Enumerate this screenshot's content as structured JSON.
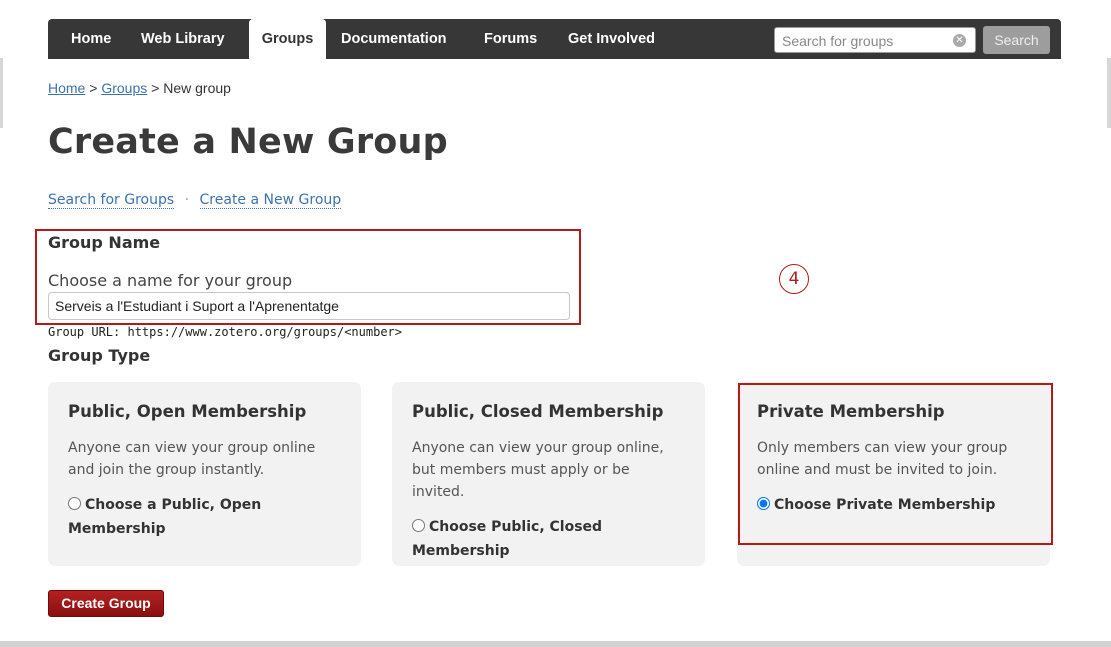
{
  "nav": {
    "items": [
      "Home",
      "Web Library",
      "Groups",
      "Documentation",
      "Forums",
      "Get Involved"
    ],
    "active": "Groups",
    "search_placeholder": "Search for groups",
    "search_button": "Search"
  },
  "breadcrumb": {
    "home": "Home",
    "sep1": ">",
    "groups": "Groups",
    "sep2": ">",
    "current": "New group"
  },
  "page_title": "Create a New Group",
  "subnav": {
    "search_groups": "Search for Groups",
    "dot": "·",
    "create_group": "Create a New Group"
  },
  "group_name": {
    "heading": "Group Name",
    "label": "Choose a name for your group",
    "value": "Serveis a l'Estudiant i Suport a l'Aprenentatge",
    "url_hint": "Group URL: https://www.zotero.org/groups/<number>"
  },
  "group_type": {
    "heading": "Group Type",
    "options": [
      {
        "title": "Public, Open Membership",
        "description": "Anyone can view your group online and join the group instantly.",
        "choice": "Choose a Public, Open Membership",
        "selected": false
      },
      {
        "title": "Public, Closed Membership",
        "description": "Anyone can view your group online, but members must apply or be invited.",
        "choice": "Choose Public, Closed Membership",
        "selected": false
      },
      {
        "title": "Private Membership",
        "description": "Only members can view your group online and must be invited to join.",
        "choice": "Choose Private Membership",
        "selected": true
      }
    ]
  },
  "create_button": "Create Group",
  "annotation": {
    "step": "4",
    "color": "#b11b1b"
  },
  "colors": {
    "navbar": "#373737",
    "link": "#3b73b0",
    "primary_button": "#a01818"
  }
}
